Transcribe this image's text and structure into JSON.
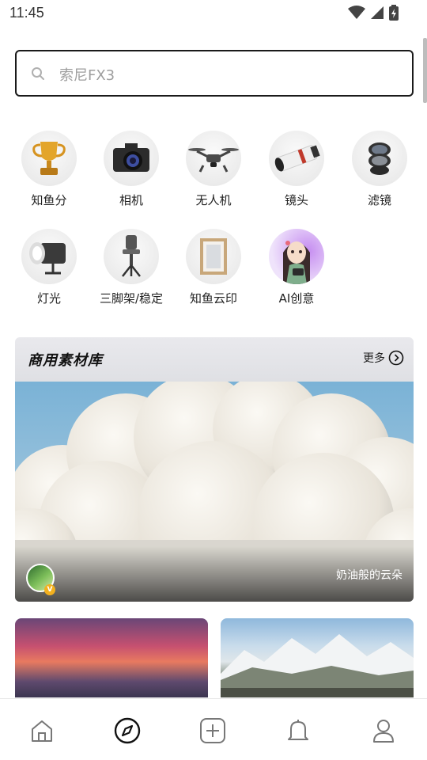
{
  "status_bar": {
    "time": "11:45"
  },
  "search": {
    "placeholder": "索尼FX3"
  },
  "categories": [
    {
      "label": "知鱼分",
      "icon": "trophy-icon"
    },
    {
      "label": "相机",
      "icon": "camera-icon"
    },
    {
      "label": "无人机",
      "icon": "drone-icon"
    },
    {
      "label": "镜头",
      "icon": "lens-icon"
    },
    {
      "label": "滤镜",
      "icon": "filter-icon"
    },
    {
      "label": "灯光",
      "icon": "light-icon"
    },
    {
      "label": "三脚架/稳定",
      "icon": "gimbal-icon"
    },
    {
      "label": "知鱼云印",
      "icon": "frame-icon"
    },
    {
      "label": "AI创意",
      "icon": "ai-character-icon"
    }
  ],
  "material_section": {
    "title": "商用素材库",
    "more_label": "更多",
    "featured": {
      "caption": "奶油般的云朵",
      "badge": "V"
    }
  },
  "bottom_nav": [
    {
      "name": "home-icon"
    },
    {
      "name": "compass-icon",
      "active": true
    },
    {
      "name": "add-icon"
    },
    {
      "name": "bell-icon"
    },
    {
      "name": "profile-icon"
    }
  ],
  "colors": {
    "accent": "#1a1a1a",
    "placeholder": "#9e9e9e",
    "badge": "#f2b01e"
  }
}
